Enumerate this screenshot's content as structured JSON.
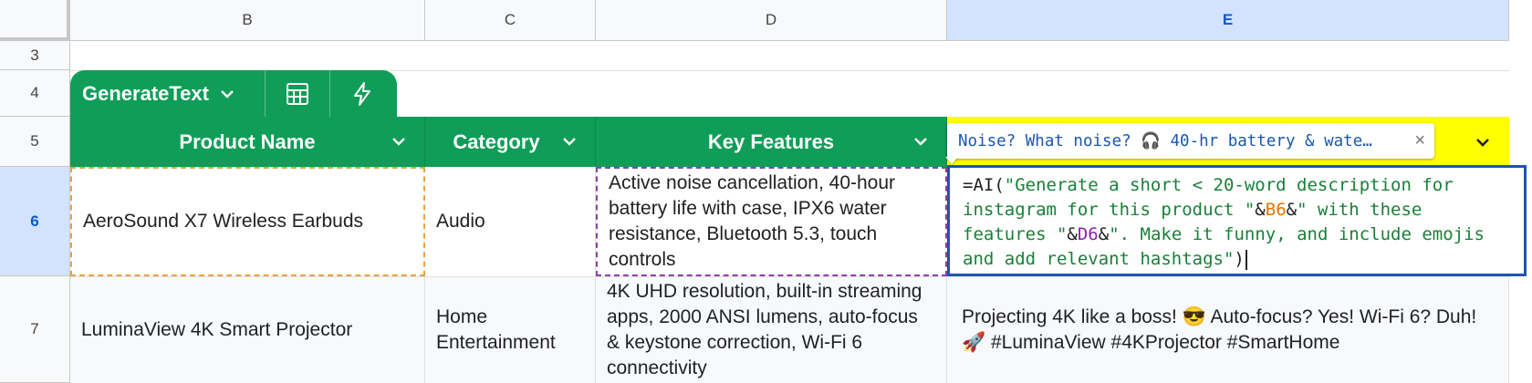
{
  "columns": [
    "B",
    "C",
    "D",
    "E"
  ],
  "rows": [
    "3",
    "4",
    "5",
    "6",
    "7"
  ],
  "tab": {
    "name": "GenerateText",
    "icons": [
      "chevron-down-icon",
      "calculator-icon",
      "lightning-icon"
    ]
  },
  "headers": [
    "Product Name",
    "Category",
    "Key Features"
  ],
  "row6": {
    "product": "AeroSound X7 Wireless Earbuds",
    "category": "Audio",
    "features": "Active noise cancellation, 40-hour battery life with case, IPX6 water resistance, Bluetooth 5.3, touch controls"
  },
  "row7": {
    "product": "LuminaView 4K Smart Projector",
    "category": "Home Entertainment",
    "features": "4K UHD resolution, built-in streaming apps, 2000 ANSI lumens, auto-focus & keystone correction, Wi-Fi 6 connectivity",
    "output": "Projecting 4K like a boss! 😎  Auto-focus? Yes! Wi-Fi 6? Duh! 🚀  #LuminaView #4KProjector #SmartHome"
  },
  "banner": {
    "text": "Noise? What noise? 🎧 40-hr battery & wate…",
    "close": "×"
  },
  "formula": {
    "p1": "=AI(",
    "s1": "\"Generate a short < 20-word description for instagram for this product \"",
    "amp1": "&",
    "ref1": "B6",
    "amp2": "&",
    "s2": "\" with these features \"",
    "amp3": "&",
    "ref2": "D6",
    "amp4": "&",
    "s3": "\". Make it funny, and include emojis and add relevant hashtags\"",
    "p2": ")"
  },
  "colors": {
    "green": "#0f9d58",
    "yellow": "#ffff00",
    "selected_header": "#d3e3fd",
    "formula_border": "#1a56b0"
  }
}
